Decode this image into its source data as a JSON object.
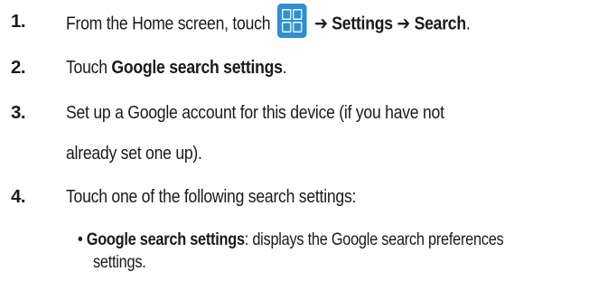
{
  "steps": [
    {
      "number": "1.",
      "prefix": "From the Home screen, touch",
      "arrow1": "➔",
      "settings": "Settings",
      "arrow2": "➔",
      "search": "Search",
      "end": "."
    },
    {
      "number": "2.",
      "prefix": "Touch",
      "bold": "Google search settings",
      "end": "."
    },
    {
      "number": "3.",
      "line1": "Set up a Google account for this device (if you have not",
      "line2": "already set one up)."
    },
    {
      "number": "4.",
      "text": "Touch one of the following search settings:"
    }
  ],
  "bullets": [
    {
      "marker": "•",
      "bold": "Google search settings",
      "rest": ": displays the Google search preferences",
      "cont": "settings."
    }
  ],
  "colors": {
    "icon_bg": "#2e8fd4",
    "text": "#1a1a1a"
  },
  "icons": {
    "apps": "apps-grid-icon"
  }
}
